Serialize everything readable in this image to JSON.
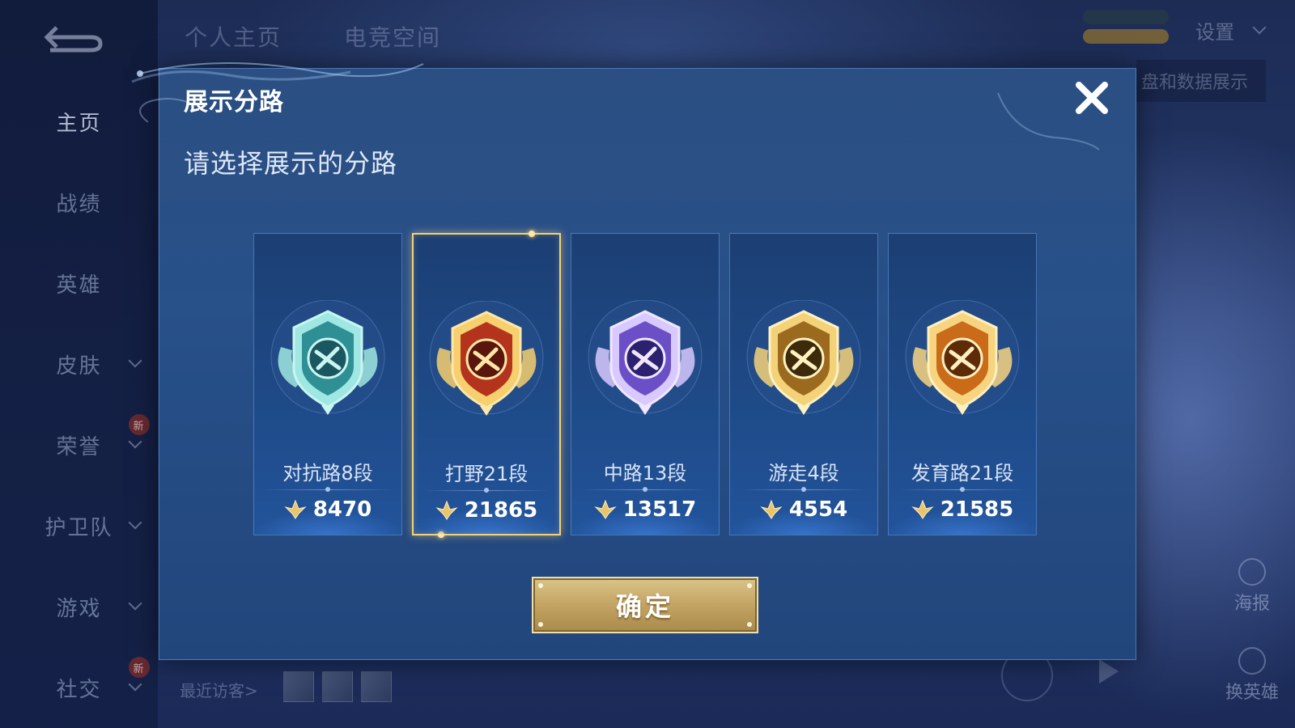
{
  "nav": {
    "items": [
      {
        "label": "主页",
        "active": true,
        "chevron": false,
        "badge": ""
      },
      {
        "label": "战绩",
        "active": false,
        "chevron": false,
        "badge": ""
      },
      {
        "label": "英雄",
        "active": false,
        "chevron": false,
        "badge": ""
      },
      {
        "label": "皮肤",
        "active": false,
        "chevron": true,
        "badge": ""
      },
      {
        "label": "荣誉",
        "active": false,
        "chevron": true,
        "badge": "新"
      },
      {
        "label": "护卫队",
        "active": false,
        "chevron": true,
        "badge": ""
      },
      {
        "label": "游戏",
        "active": false,
        "chevron": true,
        "badge": ""
      },
      {
        "label": "社交",
        "active": false,
        "chevron": true,
        "badge": "新"
      }
    ]
  },
  "header": {
    "tabs": [
      "个人主页",
      "电竞空间"
    ],
    "settings_label": "设置",
    "data_banner": "盘和数据展示"
  },
  "side_buttons": [
    {
      "label": "海报",
      "icon": "poster-icon"
    },
    {
      "label": "换英雄",
      "icon": "hero-swap-icon"
    }
  ],
  "visitors": {
    "label": "最近访客>",
    "count": 3
  },
  "dialog": {
    "title": "展示分路",
    "subtitle": "请选择展示的分路",
    "confirm_label": "确定",
    "lanes": [
      {
        "name": "对抗路8段",
        "score": "8470",
        "selected": false,
        "emblem": "clash-lane-emblem-icon",
        "palette": "teal"
      },
      {
        "name": "打野21段",
        "score": "21865",
        "selected": true,
        "emblem": "jungle-emblem-icon",
        "palette": "red-gold"
      },
      {
        "name": "中路13段",
        "score": "13517",
        "selected": false,
        "emblem": "mid-lane-emblem-icon",
        "palette": "purple"
      },
      {
        "name": "游走4段",
        "score": "4554",
        "selected": false,
        "emblem": "roam-emblem-icon",
        "palette": "gold"
      },
      {
        "name": "发育路21段",
        "score": "21585",
        "selected": false,
        "emblem": "farm-lane-emblem-icon",
        "palette": "orange-gold"
      }
    ]
  },
  "colors": {
    "accent_gold": "#f1d17a",
    "dialog_bg": "#285089",
    "confirm_gold": "#c4a463"
  }
}
